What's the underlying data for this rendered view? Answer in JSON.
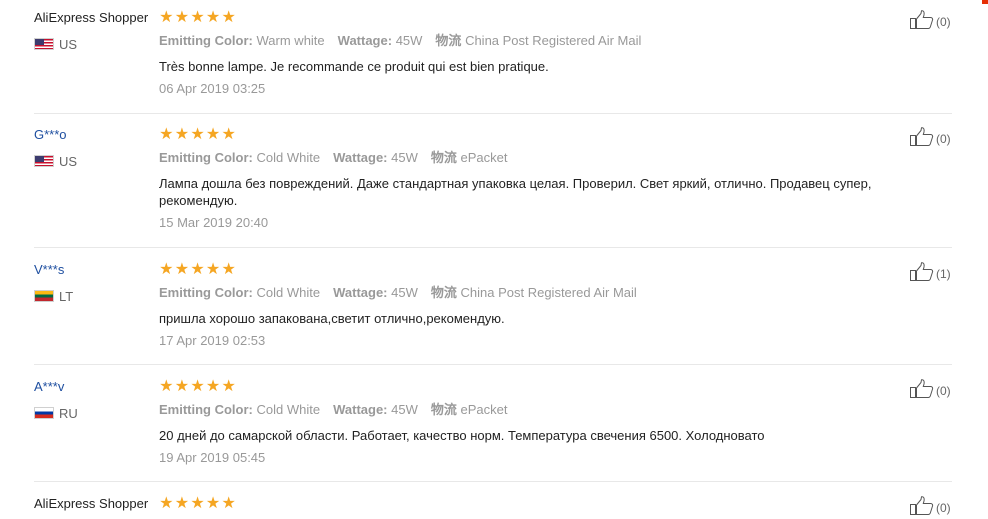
{
  "reviews": [
    {
      "user": "AliExpress Shopper",
      "country": "US",
      "flag": "us-flag-icon",
      "stars": 5,
      "attrs": [
        {
          "label": "Emitting Color:",
          "value": "Warm white"
        },
        {
          "label": "Wattage:",
          "value": "45W"
        },
        {
          "label": "物流",
          "value": "China Post Registered Air Mail"
        }
      ],
      "text": "Très bonne lampe. Je recommande ce produit qui est bien pratique.",
      "date": "06 Apr 2019 03:25",
      "helpful": "(0)"
    },
    {
      "user": "G***o",
      "country": "US",
      "flag": "us-flag-icon",
      "stars": 5,
      "attrs": [
        {
          "label": "Emitting Color:",
          "value": "Cold White"
        },
        {
          "label": "Wattage:",
          "value": "45W"
        },
        {
          "label": "物流",
          "value": "ePacket"
        }
      ],
      "text": "Лампа дошла без повреждений. Даже стандартная упаковка целая. Проверил. Свет яркий, отлично. Продавец супер, рекомендую.",
      "date": "15 Mar 2019 20:40",
      "helpful": "(0)"
    },
    {
      "user": "V***s",
      "country": "LT",
      "flag": "lt-flag-icon",
      "stars": 5,
      "attrs": [
        {
          "label": "Emitting Color:",
          "value": "Cold White"
        },
        {
          "label": "Wattage:",
          "value": "45W"
        },
        {
          "label": "物流",
          "value": "China Post Registered Air Mail"
        }
      ],
      "text": "пришла хорошо запакована,светит отлично,рекомендую.",
      "date": "17 Apr 2019 02:53",
      "helpful": "(1)"
    },
    {
      "user": "A***v",
      "country": "RU",
      "flag": "ru-flag-icon",
      "stars": 5,
      "attrs": [
        {
          "label": "Emitting Color:",
          "value": "Cold White"
        },
        {
          "label": "Wattage:",
          "value": "45W"
        },
        {
          "label": "物流",
          "value": "ePacket"
        }
      ],
      "text": "20 дней до самарской области. Работает, качество норм. Температура свечения 6500. Холодновато",
      "date": "19 Apr 2019 05:45",
      "helpful": "(0)"
    },
    {
      "user": "AliExpress Shopper",
      "country": "",
      "flag": "",
      "stars": 5,
      "attrs": [],
      "text": "",
      "date": "",
      "helpful": "(0)"
    }
  ],
  "colors": {
    "star": "#f5a623",
    "masked_user": "#1f4fa0",
    "muted": "#999999",
    "accent": "#e62e04"
  },
  "icons": {
    "star": "star-icon",
    "helpful": "thumbs-up-icon"
  }
}
